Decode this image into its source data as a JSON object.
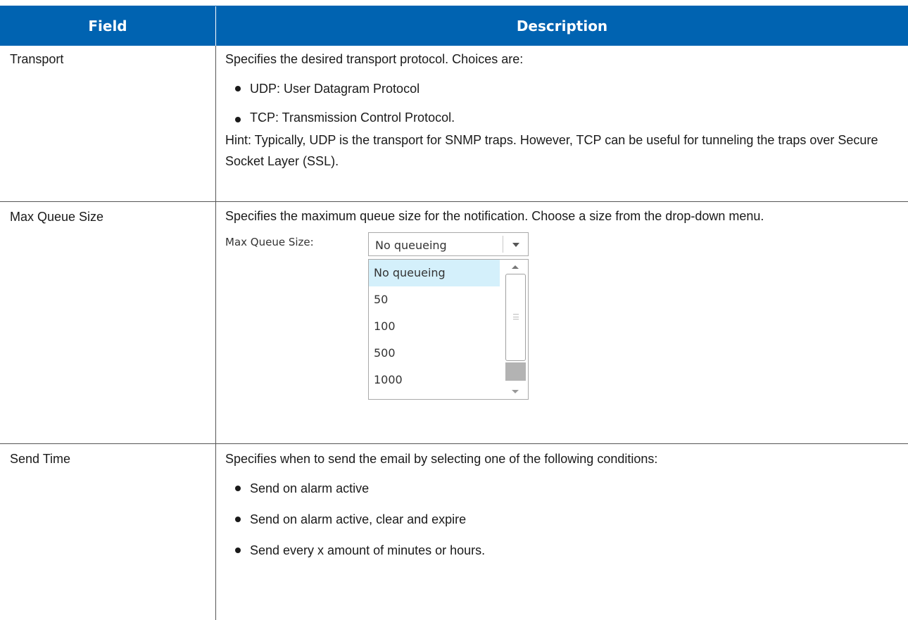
{
  "header": {
    "field": "Field",
    "description": "Description"
  },
  "rows": [
    {
      "field": "Transport",
      "intro": "Specifies the desired transport protocol. Choices are:",
      "bullets": [
        "UDP: User Datagram Protocol",
        "TCP: Transmission Control Protocol."
      ],
      "hint": "Hint: Typically, UDP is the transport for SNMP traps. However, TCP can be useful for tunneling the traps over Secure Socket Layer (SSL)."
    },
    {
      "field": "Max Queue Size",
      "intro": "Specifies the maximum queue size for the notification. Choose a size from the drop-down menu.",
      "widget": {
        "label": "Max Queue Size:",
        "selected": "No queueing",
        "options": [
          "No queueing",
          "50",
          "100",
          "500",
          "1000"
        ]
      }
    },
    {
      "field": "Send Time",
      "intro": "Specifies when to send the email by selecting one of the following conditions:",
      "bullets": [
        "Send on alarm active",
        "Send on alarm active, clear and expire",
        "Send every x amount of minutes or hours."
      ]
    }
  ]
}
